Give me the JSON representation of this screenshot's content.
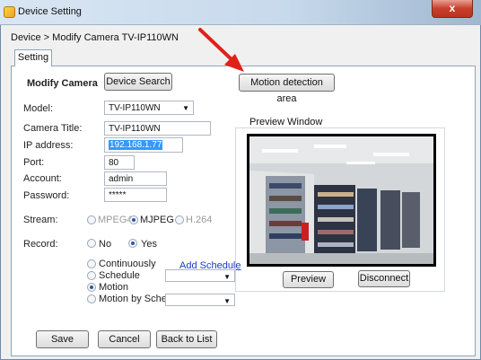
{
  "window": {
    "title": "Device Setting",
    "close_glyph": "x"
  },
  "breadcrumb": "Device > Modify Camera TV-IP110WN",
  "tabs": [
    {
      "label": "Setting"
    }
  ],
  "form": {
    "heading": "Modify Camera",
    "device_search_label": "Device Search",
    "motion_area_label": "Motion detection area",
    "model": {
      "label": "Model:",
      "value": "TV-IP110WN"
    },
    "camera_title": {
      "label": "Camera Title:",
      "value": "TV-IP110WN"
    },
    "ip_address": {
      "label": "IP address:",
      "value": "192.168.1.77"
    },
    "port": {
      "label": "Port:",
      "value": "80"
    },
    "account": {
      "label": "Account:",
      "value": "admin"
    },
    "password": {
      "label": "Password:",
      "value": "*****"
    },
    "stream": {
      "label": "Stream:",
      "options": [
        "MPEG4",
        "MJPEG",
        "H.264"
      ],
      "selected": "MJPEG"
    },
    "record": {
      "label": "Record:",
      "options": [
        "No",
        "Yes"
      ],
      "selected": "Yes"
    },
    "record_mode": {
      "options": [
        "Continuously",
        "Schedule",
        "Motion",
        "Motion by Sched"
      ],
      "selected": "Motion",
      "add_schedule_link": "Add Schedule"
    }
  },
  "preview": {
    "title": "Preview Window",
    "preview_label": "Preview",
    "disconnect_label": "Disconnect"
  },
  "footer": {
    "save_label": "Save",
    "cancel_label": "Cancel",
    "back_label": "Back to List"
  },
  "colors": {
    "annotation_arrow": "#e0201a",
    "link": "#1a3ac4",
    "selection": "#3399ff"
  }
}
